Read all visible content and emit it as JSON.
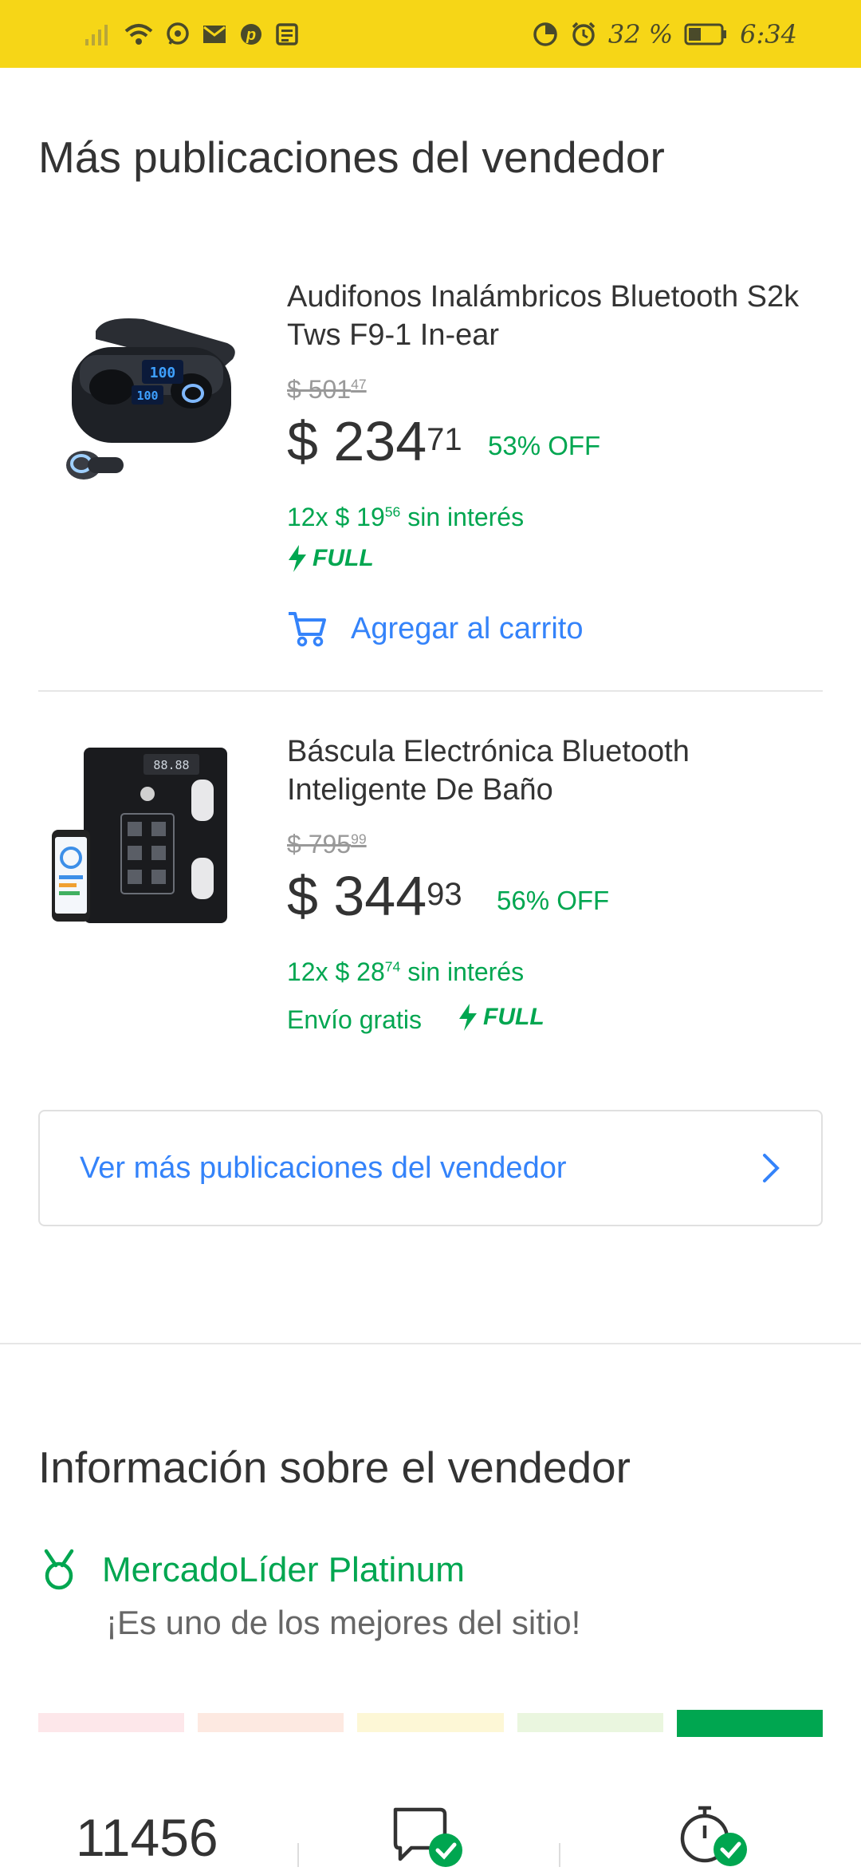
{
  "status_bar": {
    "battery_percent": "32 %",
    "time": "6:34",
    "left_icons": [
      "signal-icon",
      "wifi-icon",
      "whatsapp-icon",
      "mail-icon",
      "pinterest-icon",
      "news-icon"
    ],
    "right_icons": [
      "data-saver-icon",
      "alarm-icon",
      "battery-icon"
    ],
    "background": "#f6d617"
  },
  "more_section": {
    "title": "Más publicaciones del vendedor",
    "items": [
      {
        "title": "Audifonos Inalámbricos Bluetooth S2k Tws F9-1 In-ear",
        "old_price_int": "$ 501",
        "old_price_cents": "47",
        "price_int": "$ 234",
        "price_cents": "71",
        "discount": "53% OFF",
        "installments_prefix": "12x $ 19",
        "installments_cents": "56",
        "installments_suffix": " sin interés",
        "full_label": "FULL",
        "cart_label": "Agregar al carrito"
      },
      {
        "title": "Báscula Electrónica Bluetooth Inteligente De Baño",
        "old_price_int": "$ 795",
        "old_price_cents": "99",
        "price_int": "$ 344",
        "price_cents": "93",
        "discount": "56% OFF",
        "installments_prefix": "12x $ 28",
        "installments_cents": "74",
        "installments_suffix": " sin interés",
        "shipping": "Envío gratis",
        "full_label": "FULL"
      }
    ],
    "more_button": "Ver más publicaciones del vendedor"
  },
  "seller_section": {
    "title": "Información sobre el vendedor",
    "leader_name": "MercadoLíder Platinum",
    "leader_sub": "¡Es uno de los mejores del sitio!",
    "reputation_colors": [
      "#fde7ea",
      "#fde9e1",
      "#fdf7d6",
      "#eaf6df",
      "#00a650"
    ],
    "sales_count": "11456"
  },
  "colors": {
    "accent_blue": "#3483fa",
    "green": "#00a650"
  }
}
